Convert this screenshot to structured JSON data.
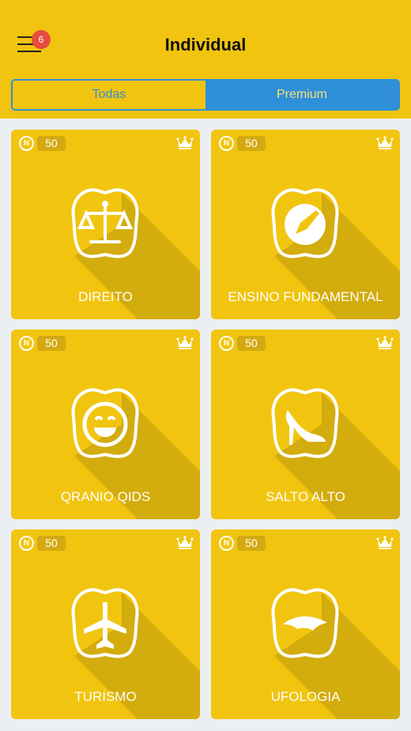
{
  "header": {
    "title": "Individual",
    "notification_count": "6",
    "menu_icon": "hamburger-menu-icon"
  },
  "tabs": [
    {
      "label": "Todas",
      "selected": false
    },
    {
      "label": "Premium",
      "selected": true
    }
  ],
  "colors": {
    "primary": "#F1C40F",
    "accent": "#2F8FD8",
    "badge": "#E74C3C"
  },
  "cards": [
    {
      "label": "DIREITO",
      "price": "50",
      "coin": "N",
      "icon": "scales-of-justice-icon"
    },
    {
      "label": "ENSINO FUNDAMENTAL",
      "price": "50",
      "coin": "N",
      "icon": "pencil-icon"
    },
    {
      "label": "QRANIO QIDS",
      "price": "50",
      "coin": "N",
      "icon": "smiley-face-icon"
    },
    {
      "label": "SALTO ALTO",
      "price": "50",
      "coin": "N",
      "icon": "high-heel-icon"
    },
    {
      "label": "TURISMO",
      "price": "50",
      "coin": "N",
      "icon": "airplane-icon"
    },
    {
      "label": "UFOLOGIA",
      "price": "50",
      "coin": "N",
      "icon": "ufo-icon"
    }
  ]
}
